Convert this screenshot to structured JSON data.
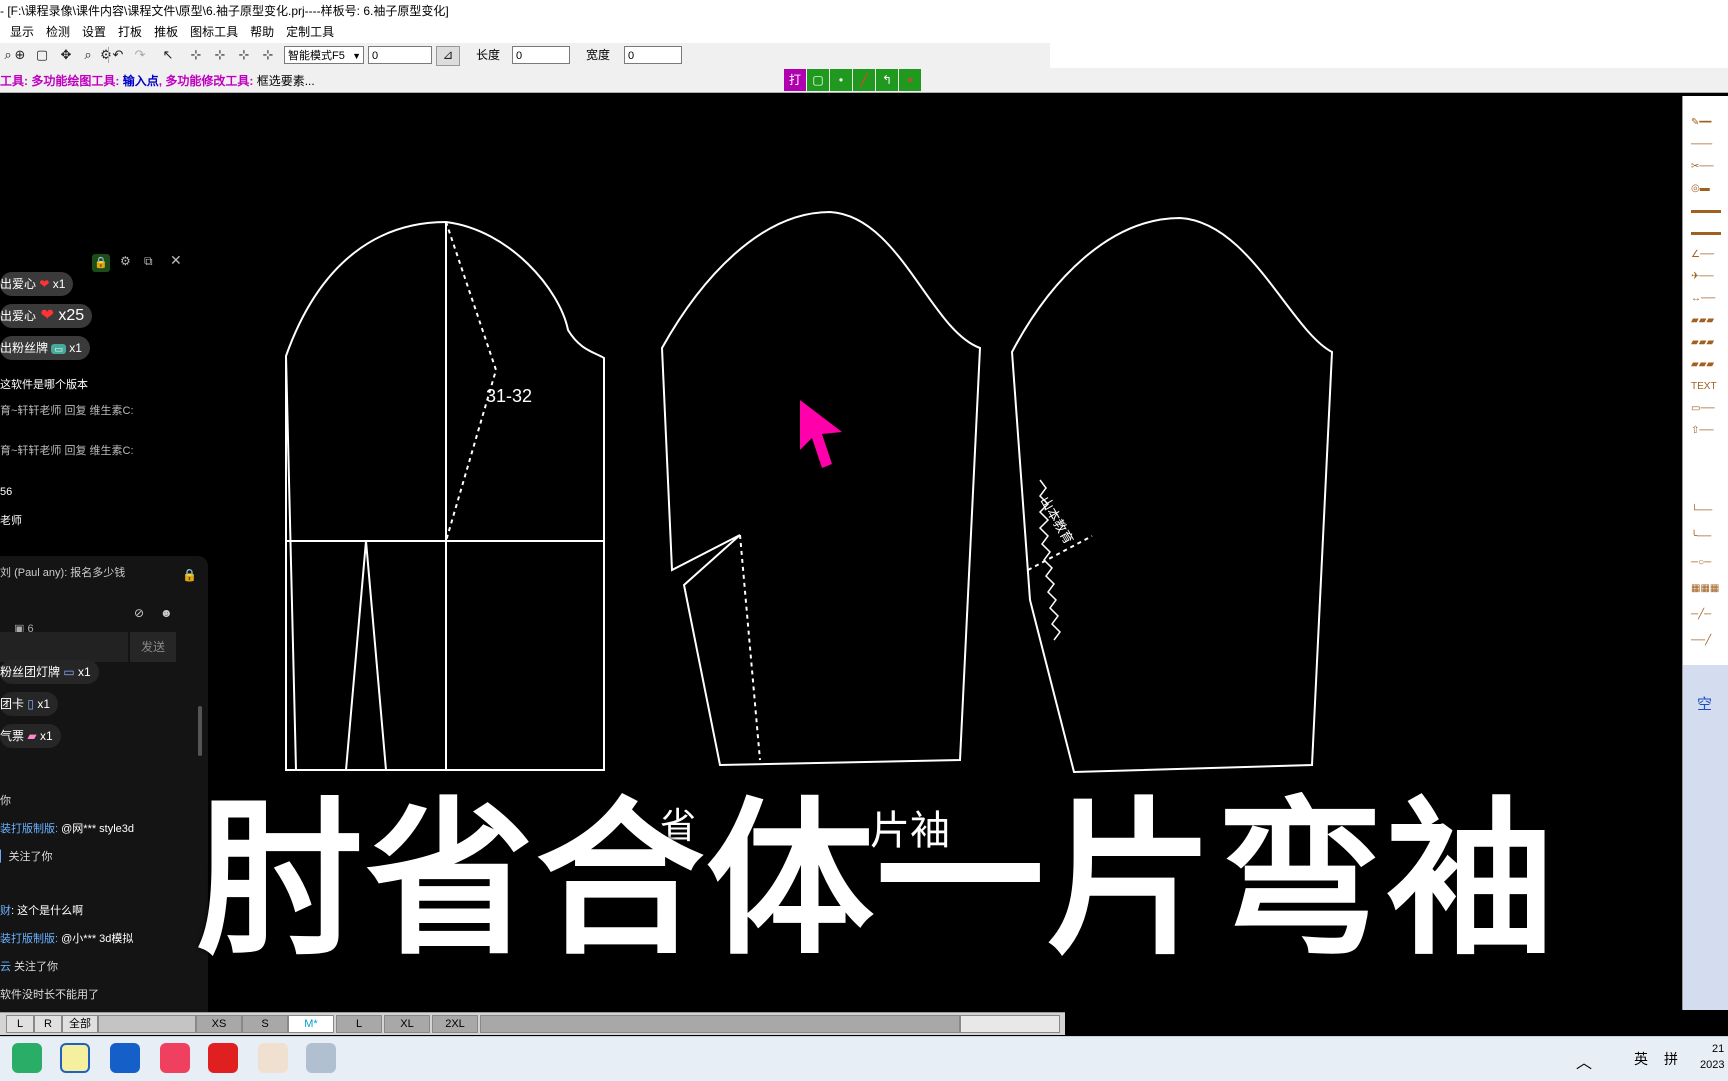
{
  "window_title": "- [F:\\课程录像\\课件内容\\课程文件\\原型\\6.袖子原型变化.prj----样板号: 6.袖子原型变化]",
  "menu": [
    "显示",
    "检测",
    "设置",
    "打板",
    "推板",
    "图标工具",
    "帮助",
    "定制工具"
  ],
  "toolbar": {
    "mode_select": "智能模式F5",
    "value_input": "0",
    "length_label": "长度",
    "length_value": "0",
    "width_label": "宽度",
    "width_value": "0"
  },
  "status": {
    "prefix": "工具: ",
    "tool": "多功能绘图工具: ",
    "input": "输入点",
    "sep": ", ",
    "modify": "多功能修改工具: ",
    "hint": "框选要素..."
  },
  "status_buttons": [
    "打",
    "",
    "",
    "",
    "",
    ""
  ],
  "canvas": {
    "label_31_32": "31-32",
    "handwritten_1": "山本教育",
    "handwritten_2": "片袖",
    "handwritten_3": "省"
  },
  "chat": {
    "toolbar_icons": [
      "lock-icon",
      "settings-icon",
      "popout-icon",
      "close-icon"
    ],
    "gifts_top": [
      {
        "text": "出爱心",
        "count": "x1"
      },
      {
        "text": "出爱心",
        "count": "x25"
      },
      {
        "text": "出粉丝牌",
        "count": "x1"
      }
    ],
    "messages_top": [
      "这软件是哪个版本",
      "育~轩轩老师 回复 维生素C:",
      "育~轩轩老师 回复 维生素C:",
      "56",
      "老师"
    ],
    "pinned_message": "(Paul any): 报名多少钱",
    "pinned_prefix": "刘",
    "online_count": "6",
    "send_label": "发送",
    "gifts_bottom": [
      {
        "text": "粉丝团灯牌",
        "count": "x1"
      },
      {
        "text": "团卡",
        "count": "x1"
      },
      {
        "text": "气票",
        "count": "x1"
      }
    ],
    "messages_bottom": [
      {
        "name": "",
        "text": "你"
      },
      {
        "name": "装打版制版:",
        "text": " @网*** style3d"
      },
      {
        "name": "",
        "text": "关注了你"
      },
      {
        "name": "财",
        "text": ": 这个是什么啊"
      },
      {
        "name": "装打版制版:",
        "text": " @小*** 3d模拟"
      },
      {
        "name": "云",
        "text": " 关注了你"
      },
      {
        "name": "",
        "text": "软件没时长不能用了"
      }
    ]
  },
  "size_bar": {
    "left_buttons": [
      "L",
      "R",
      "全部"
    ],
    "sizes": [
      "XS",
      "S",
      "M*",
      "L",
      "XL",
      "2XL"
    ],
    "active": "M*"
  },
  "right_panel": {
    "empty_label": "空"
  },
  "taskbar": {
    "ime": "英",
    "ime2": "拼",
    "clock_hour": "21",
    "clock_year": "2023"
  },
  "overlay_caption": "肘省合体一片弯袖",
  "colors": {
    "canvas_bg": "#000000",
    "pattern_line": "#ffffff",
    "cursor": "#ff00aa"
  }
}
